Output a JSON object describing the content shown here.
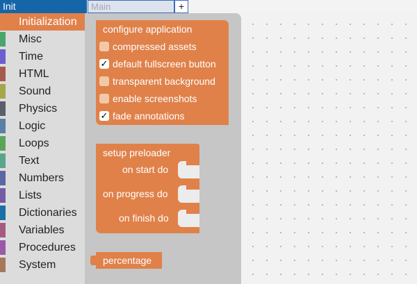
{
  "topbar": {
    "screen_tab": "Init",
    "screen_input_placeholder": "Main",
    "add_button": "+"
  },
  "sidebar": {
    "items": [
      {
        "label": "Initialization",
        "color": "#e0814a",
        "selected": true
      },
      {
        "label": "Misc",
        "color": "#4aa66a"
      },
      {
        "label": "Time",
        "color": "#6b5fd0"
      },
      {
        "label": "HTML",
        "color": "#a55a4e"
      },
      {
        "label": "Sound",
        "color": "#a6a64a"
      },
      {
        "label": "Physics",
        "color": "#5c5f6a"
      },
      {
        "label": "Logic",
        "color": "#5b80a5"
      },
      {
        "label": "Loops",
        "color": "#5ba55b"
      },
      {
        "label": "Text",
        "color": "#5ba58c"
      },
      {
        "label": "Numbers",
        "color": "#5b67a5"
      },
      {
        "label": "Lists",
        "color": "#745ba5"
      },
      {
        "label": "Dictionaries",
        "color": "#1a6fa8"
      },
      {
        "label": "Variables",
        "color": "#a55b80"
      },
      {
        "label": "Procedures",
        "color": "#995ba5"
      },
      {
        "label": "System",
        "color": "#a5785b"
      }
    ]
  },
  "blocks": {
    "configure": {
      "title": "configure application",
      "options": [
        {
          "label": "compressed assets",
          "checked": false
        },
        {
          "label": "default fullscreen button",
          "checked": true
        },
        {
          "label": "transparent background",
          "checked": false
        },
        {
          "label": "enable screenshots",
          "checked": false
        },
        {
          "label": "fade annotations",
          "checked": true
        }
      ]
    },
    "preloader": {
      "title": "setup preloader",
      "on_start": "on start do",
      "on_progress": "on progress do",
      "on_finish": "on finish do"
    },
    "percentage": {
      "label": "percentage"
    }
  },
  "colors": {
    "block": "#e0814a",
    "tab_active": "#1565a8",
    "flyout": "#c6c6c6",
    "sidebar": "#dcdcdc"
  }
}
